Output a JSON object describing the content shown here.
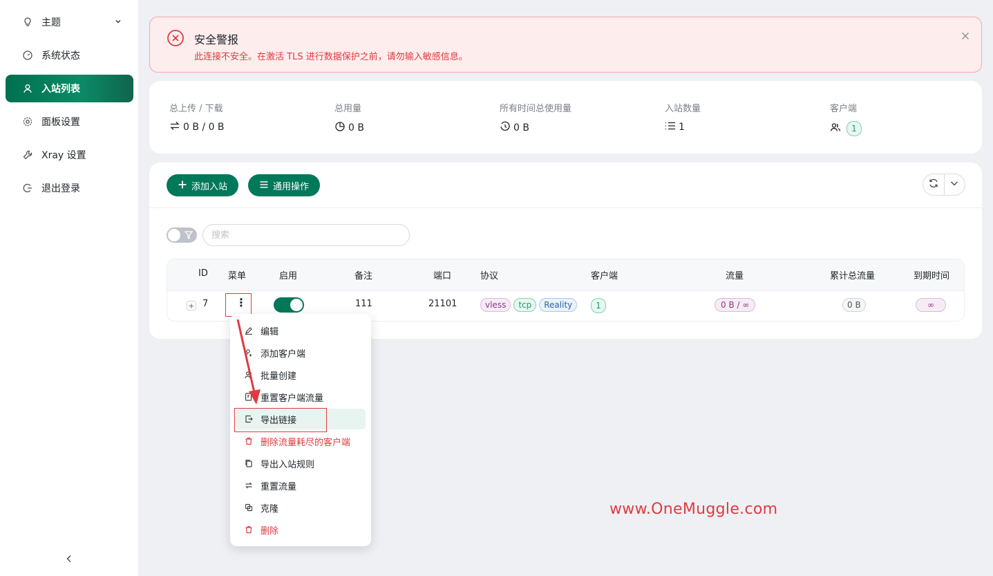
{
  "sidebar": {
    "items": [
      {
        "label": "主题",
        "icon": "bulb-icon"
      },
      {
        "label": "系统状态",
        "icon": "dashboard-icon"
      },
      {
        "label": "入站列表",
        "icon": "user-icon"
      },
      {
        "label": "面板设置",
        "icon": "gear-icon"
      },
      {
        "label": "Xray 设置",
        "icon": "wrench-icon"
      },
      {
        "label": "退出登录",
        "icon": "logout-icon"
      }
    ],
    "active_index": 2
  },
  "alert": {
    "title": "安全警报",
    "message": "此连接不安全。在激活 TLS 进行数据保护之前，请勿输入敏感信息。"
  },
  "stats": {
    "upload_download": {
      "label": "总上传 / 下载",
      "value": "0 B / 0 B"
    },
    "total_usage": {
      "label": "总用量",
      "value": "0 B"
    },
    "all_time_usage": {
      "label": "所有时间总使用量",
      "value": "0 B"
    },
    "inbound_count": {
      "label": "入站数量",
      "value": "1"
    },
    "clients": {
      "label": "客户端",
      "value": "1"
    }
  },
  "toolbar": {
    "add_inbound": "添加入站",
    "general_ops": "通用操作"
  },
  "search": {
    "placeholder": "搜索",
    "value": ""
  },
  "table": {
    "headers": [
      "ID",
      "菜单",
      "启用",
      "备注",
      "端口",
      "协议",
      "客户端",
      "流量",
      "累计总流量",
      "到期时间"
    ],
    "rows": [
      {
        "id": "7",
        "enabled": true,
        "remark": "111",
        "port": "21101",
        "protocols": [
          "vless",
          "tcp",
          "Reality"
        ],
        "clients": "1",
        "traffic": "0 B / ∞",
        "total_traffic": "0 B",
        "expiry": "∞"
      }
    ]
  },
  "context_menu": {
    "items": [
      {
        "label": "编辑",
        "icon": "edit-icon"
      },
      {
        "label": "添加客户端",
        "icon": "user-add-icon"
      },
      {
        "label": "批量创建",
        "icon": "users-icon"
      },
      {
        "label": "重置客户端流量",
        "icon": "file-reset-icon"
      },
      {
        "label": "导出链接",
        "icon": "export-icon"
      },
      {
        "label": "删除流量耗尽的客户端",
        "icon": "delete-icon"
      },
      {
        "label": "导出入站规则",
        "icon": "copy-icon"
      },
      {
        "label": "重置流量",
        "icon": "swap-icon"
      },
      {
        "label": "克隆",
        "icon": "clone-icon"
      },
      {
        "label": "删除",
        "icon": "delete-icon"
      }
    ]
  },
  "watermark": "www.OneMuggle.com",
  "colors": {
    "primary": "#00785a",
    "danger": "#e03a3e",
    "alert_bg": "#fdeded",
    "page_bg": "#eef0f4"
  }
}
